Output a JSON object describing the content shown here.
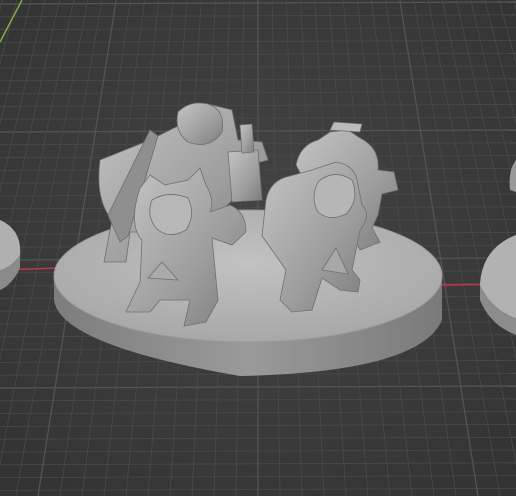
{
  "viewport": {
    "background_color": "#3d3d3d",
    "grid_minor_color": "#4a4a4a",
    "grid_major_color": "#555555",
    "axis_x_color": "#c8324a",
    "axis_y_color": "#7fb03a",
    "model_color": "#a6a6a6",
    "model_shadow_color": "#6e6e6e",
    "model_highlight_color": "#c9c9c9",
    "base_top_color": "#b4b4b4",
    "base_side_color": "#8e8e8e"
  },
  "scene": {
    "objects": [
      {
        "name": "center-base-miniature-group",
        "selected": false
      },
      {
        "name": "left-base-partial",
        "selected": false
      },
      {
        "name": "right-base-partial",
        "selected": false
      }
    ]
  }
}
